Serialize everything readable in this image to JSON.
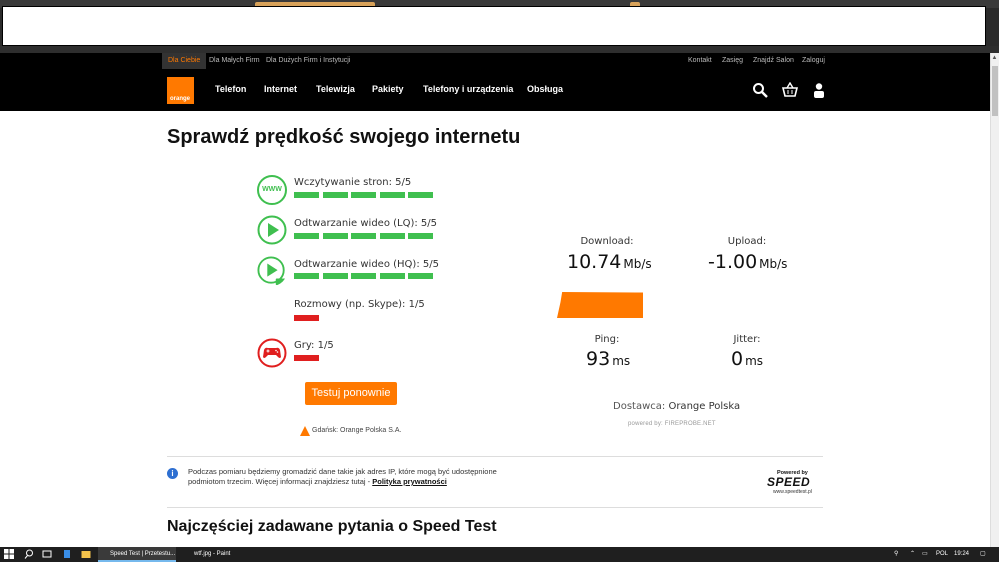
{
  "site_nav": {
    "segments": [
      "Dla Ciebie",
      "Dla Małych Firm",
      "Dla Dużych Firm i Instytucji"
    ],
    "utility_links": [
      "Kontakt",
      "Zasięg",
      "Znajdź Salon",
      "Zaloguj"
    ],
    "logo_text": "orange",
    "main_items": [
      "Telefon",
      "Internet",
      "Telewizja",
      "Pakiety",
      "Telefony i urządzenia",
      "Obsługa"
    ],
    "icons": [
      "search-icon",
      "basket-icon",
      "user-icon"
    ]
  },
  "page": {
    "title": "Sprawdź prędkość swojego internetu",
    "ratings": [
      {
        "label": "Wczytywanie stron: 5/5",
        "score": 5,
        "max": 5,
        "icon": "www-icon",
        "color": "#3fbf4f"
      },
      {
        "label": "Odtwarzanie wideo (LQ): 5/5",
        "score": 5,
        "max": 5,
        "icon": "play-icon",
        "color": "#3fbf4f"
      },
      {
        "label": "Odtwarzanie wideo (HQ): 5/5",
        "score": 5,
        "max": 5,
        "icon": "play-hd-icon",
        "badge": "HD",
        "color": "#3fbf4f"
      },
      {
        "label": "Rozmowy (np. Skype): 1/5",
        "score": 1,
        "max": 5,
        "icon": "none",
        "color": "#e01f1f"
      },
      {
        "label": "Gry: 1/5",
        "score": 1,
        "max": 5,
        "icon": "gamepad-icon",
        "color": "#e01f1f"
      }
    ],
    "download": {
      "label": "Download:",
      "value": "10.74",
      "unit": "Mb/s"
    },
    "upload": {
      "label": "Upload:",
      "value": "-1.00",
      "unit": "Mb/s"
    },
    "ping": {
      "label": "Ping:",
      "value": "93",
      "unit": "ms"
    },
    "jitter": {
      "label": "Jitter:",
      "value": "0",
      "unit": "ms"
    },
    "retest_button": "Testuj ponownie",
    "location": "Gdańsk: Orange Polska S.A.",
    "provider_label": "Dostawca:",
    "provider_name": "Orange Polska",
    "powered_by": "powered by: FIREPROBE.NET",
    "info_text": "Podczas pomiaru będziemy gromadzić dane takie jak adres IP, które mogą być udostępnione podmiotom trzecim. Więcej informacji znajdziesz tutaj -",
    "info_link": "Polityka prywatności",
    "speedtest_logo": {
      "top": "Powered by",
      "word": "SPEED",
      "url": "www.speedtest.pl"
    },
    "faq_title": "Najczęściej zadawane pytania o Speed Test"
  },
  "taskbar": {
    "apps": [
      {
        "label": "Speed Test | Przetestu...",
        "active": true
      },
      {
        "label": "wtf.jpg - Paint",
        "active": false
      }
    ],
    "tray": {
      "lang": "POL",
      "time": "19:24"
    }
  },
  "colors": {
    "brand": "#ff7900",
    "good": "#3fbf4f",
    "bad": "#e01f1f"
  }
}
